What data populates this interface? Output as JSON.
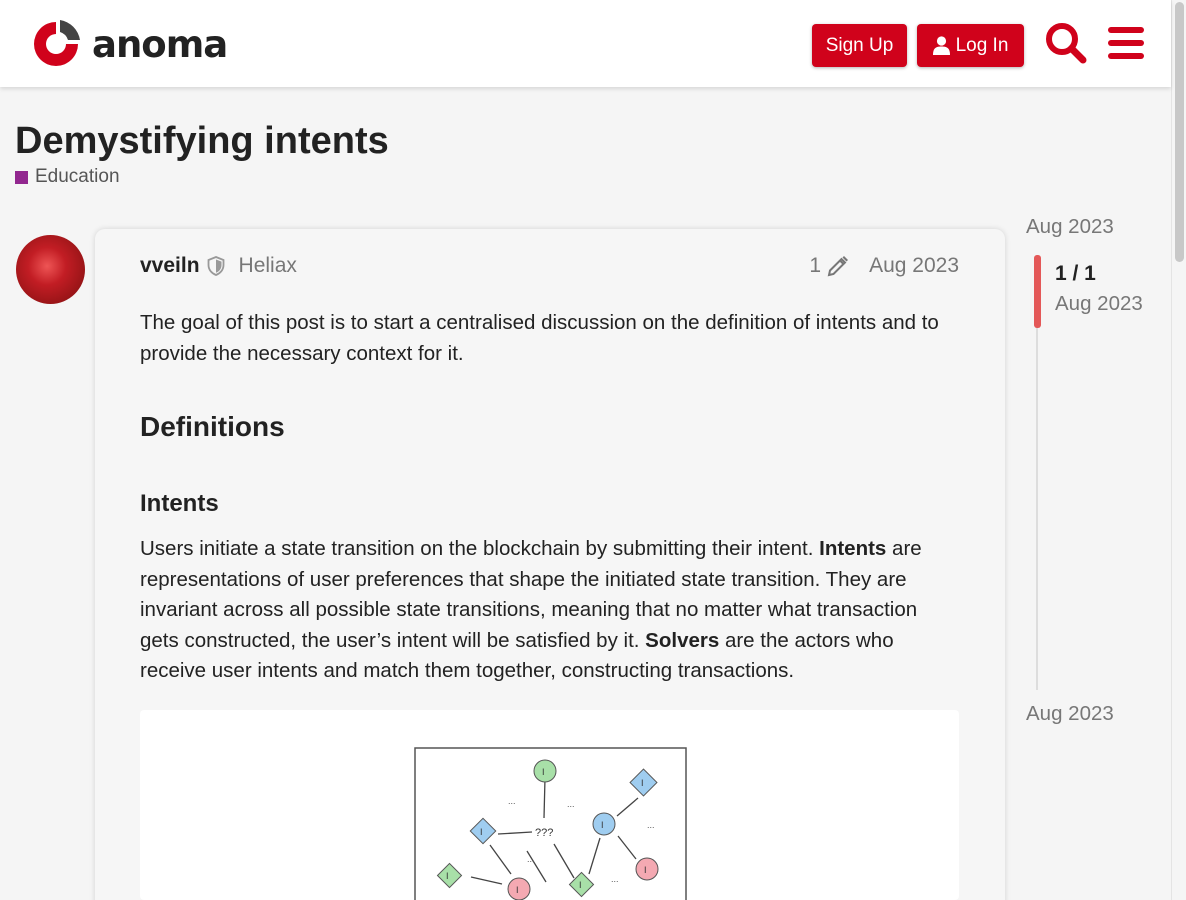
{
  "header": {
    "logo_text": "anoma",
    "signup_label": "Sign Up",
    "login_label": "Log In",
    "brand_color": "#d0021b"
  },
  "topic": {
    "title": "Demystifying intents",
    "category": "Education",
    "category_color": "#92278f"
  },
  "post": {
    "username": "vveiln",
    "user_title": "Heliax",
    "edit_count": "1",
    "date": "Aug 2023",
    "intro": "The goal of this post is to start a centralised discussion on the definition of intents and to provide the necessary context for it.",
    "heading_definitions": "Definitions",
    "heading_intents": "Intents",
    "para_intents": {
      "part1": "Users initiate a state transition on the blockchain by submitting their intent. ",
      "bold1": "Intents",
      "part2": " are representations of user preferences that shape the initiated state transition. They are invariant across all possible state transitions, meaning that no matter what transaction gets constructed, the user’s intent will be satisfied by it. ",
      "bold2": "Solvers",
      "part3": " are the actors who receive user intents and match them together, constructing transactions."
    },
    "sketch_labels": {
      "node": "I",
      "unknown": "???",
      "ellipsis": "..."
    }
  },
  "timeline": {
    "top_date": "Aug 2023",
    "count": "1 / 1",
    "handle_date": "Aug 2023",
    "bottom_date": "Aug 2023"
  }
}
